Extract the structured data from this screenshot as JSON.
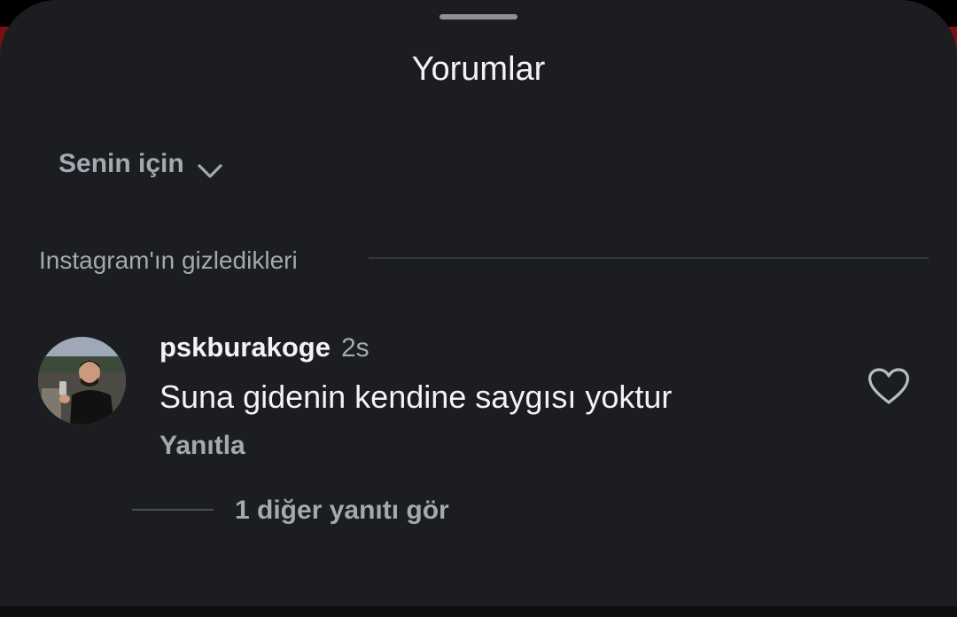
{
  "header": {
    "title": "Yorumlar"
  },
  "sort": {
    "label": "Senin için",
    "icon": "chevron-down-icon"
  },
  "hidden_section": {
    "label": "Instagram'ın gizledikleri"
  },
  "comment": {
    "username": "pskburakoge",
    "time": "2s",
    "text": "Suna gidenin kendine saygısı yoktur",
    "reply_label": "Yanıtla",
    "like_icon": "heart-outline-icon",
    "avatar_icon": "user-avatar"
  },
  "replies": {
    "label": "1 diğer yanıtı gör"
  },
  "colors": {
    "background": "#1b1d21",
    "primary_text": "#f2f3f5",
    "secondary_text": "#a4a8b0",
    "divider": "#34373d"
  }
}
